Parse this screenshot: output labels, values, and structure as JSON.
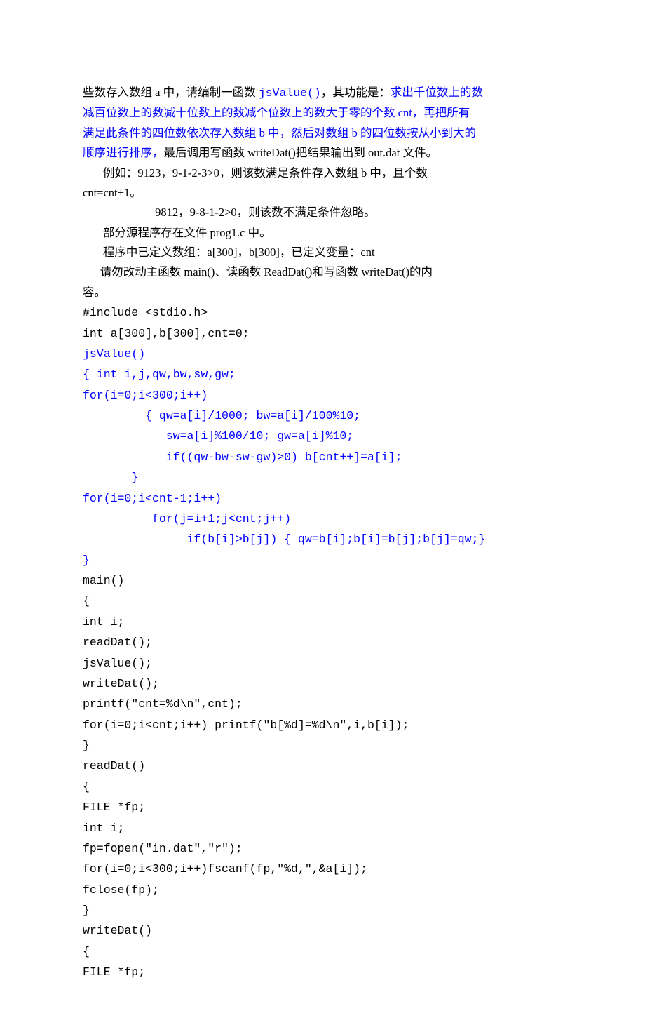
{
  "lines": [
    {
      "segments": [
        {
          "text": "些数存入数组 a 中，请编制一函数 ",
          "cls": "black"
        },
        {
          "text": "jsValue()",
          "cls": "blue mono"
        },
        {
          "text": "，其功能是：",
          "cls": "black"
        },
        {
          "text": "求出千位数上的数",
          "cls": "blue"
        }
      ]
    },
    {
      "segments": [
        {
          "text": "减百位数上的数减十位数上的数减个位数上的数大于零的个数 cnt，再把所有",
          "cls": "blue"
        }
      ]
    },
    {
      "segments": [
        {
          "text": "满足此条件的四位数依次存入数组 b 中，然后对数组 b 的四位数按从小到大的",
          "cls": "blue"
        }
      ]
    },
    {
      "segments": [
        {
          "text": "顺序进行排序，",
          "cls": "blue"
        },
        {
          "text": "最后调用写函数 writeDat()把结果输出到 out.dat 文件。",
          "cls": "black"
        }
      ]
    },
    {
      "segments": [
        {
          "text": "       例如：9123，9-1-2-3>0，则该数满足条件存入数组 b 中，且个数",
          "cls": "black"
        }
      ]
    },
    {
      "segments": [
        {
          "text": "cnt=cnt+1。",
          "cls": "black"
        }
      ]
    },
    {
      "segments": [
        {
          "text": "                         9812，9-8-1-2>0，则该数不满足条件忽略。",
          "cls": "black"
        }
      ]
    },
    {
      "segments": [
        {
          "text": "       部分源程序存在文件 prog1.c 中。",
          "cls": "black"
        }
      ]
    },
    {
      "segments": [
        {
          "text": "       程序中已定义数组：a[300]，b[300]，已定义变量：cnt",
          "cls": "black"
        }
      ]
    },
    {
      "segments": [
        {
          "text": "      请勿改动主函数 main()、读函数 ReadDat()和写函数 writeDat()的内",
          "cls": "black"
        }
      ]
    },
    {
      "segments": [
        {
          "text": "容。",
          "cls": "black"
        }
      ]
    },
    {
      "segments": [
        {
          "text": "#include <stdio.h>",
          "cls": "black mono"
        }
      ]
    },
    {
      "segments": [
        {
          "text": "int a[300],b[300],cnt=0;",
          "cls": "black mono"
        }
      ]
    },
    {
      "segments": [
        {
          "text": "jsValue()",
          "cls": "blue mono"
        }
      ]
    },
    {
      "segments": [
        {
          "text": "{ int i,j,qw,bw,sw,gw;",
          "cls": "blue mono"
        }
      ]
    },
    {
      "segments": [
        {
          "text": "for(i=0;i<300;i++)",
          "cls": "blue mono"
        }
      ]
    },
    {
      "segments": [
        {
          "text": "         { qw=a[i]/1000; bw=a[i]/100%10;",
          "cls": "blue mono"
        }
      ]
    },
    {
      "segments": [
        {
          "text": "            sw=a[i]%100/10; gw=a[i]%10;",
          "cls": "blue mono"
        }
      ]
    },
    {
      "segments": [
        {
          "text": "            if((qw-bw-sw-gw)>0) b[cnt++]=a[i];",
          "cls": "blue mono"
        }
      ]
    },
    {
      "segments": [
        {
          "text": "       }",
          "cls": "blue mono"
        }
      ]
    },
    {
      "segments": [
        {
          "text": "for(i=0;i<cnt-1;i++)",
          "cls": "blue mono"
        }
      ]
    },
    {
      "segments": [
        {
          "text": "          for(j=i+1;j<cnt;j++)",
          "cls": "blue mono"
        }
      ]
    },
    {
      "segments": [
        {
          "text": "               if(b[i]>b[j]) { qw=b[i];b[i]=b[j];b[j]=qw;}",
          "cls": "blue mono"
        }
      ]
    },
    {
      "segments": [
        {
          "text": "}",
          "cls": "blue mono"
        }
      ]
    },
    {
      "segments": [
        {
          "text": "main()",
          "cls": "black mono"
        }
      ]
    },
    {
      "segments": [
        {
          "text": "{",
          "cls": "black mono"
        }
      ]
    },
    {
      "segments": [
        {
          "text": "int i;",
          "cls": "black mono"
        }
      ]
    },
    {
      "segments": [
        {
          "text": "readDat();",
          "cls": "black mono"
        }
      ]
    },
    {
      "segments": [
        {
          "text": "jsValue();",
          "cls": "black mono"
        }
      ]
    },
    {
      "segments": [
        {
          "text": "writeDat();",
          "cls": "black mono"
        }
      ]
    },
    {
      "segments": [
        {
          "text": "printf(\"cnt=%d\\n\",cnt);",
          "cls": "black mono"
        }
      ]
    },
    {
      "segments": [
        {
          "text": "for(i=0;i<cnt;i++) printf(\"b[%d]=%d\\n\",i,b[i]);",
          "cls": "black mono"
        }
      ]
    },
    {
      "segments": [
        {
          "text": "}",
          "cls": "black mono"
        }
      ]
    },
    {
      "segments": [
        {
          "text": "readDat()",
          "cls": "black mono"
        }
      ]
    },
    {
      "segments": [
        {
          "text": "{",
          "cls": "black mono"
        }
      ]
    },
    {
      "segments": [
        {
          "text": "FILE *fp;",
          "cls": "black mono"
        }
      ]
    },
    {
      "segments": [
        {
          "text": "int i;",
          "cls": "black mono"
        }
      ]
    },
    {
      "segments": [
        {
          "text": "fp=fopen(\"in.dat\",\"r\");",
          "cls": "black mono"
        }
      ]
    },
    {
      "segments": [
        {
          "text": "for(i=0;i<300;i++)fscanf(fp,\"%d,\",&a[i]);",
          "cls": "black mono"
        }
      ]
    },
    {
      "segments": [
        {
          "text": "fclose(fp);",
          "cls": "black mono"
        }
      ]
    },
    {
      "segments": [
        {
          "text": "}",
          "cls": "black mono"
        }
      ]
    },
    {
      "segments": [
        {
          "text": "writeDat()",
          "cls": "black mono"
        }
      ]
    },
    {
      "segments": [
        {
          "text": "{",
          "cls": "black mono"
        }
      ]
    },
    {
      "segments": [
        {
          "text": "FILE *fp;",
          "cls": "black mono"
        }
      ]
    }
  ]
}
